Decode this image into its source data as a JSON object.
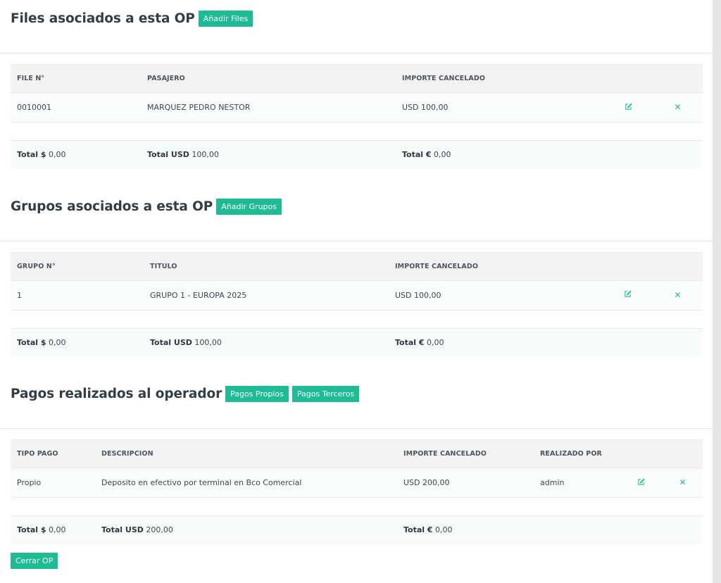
{
  "files_section": {
    "title": "Files asociados a esta OP",
    "add_button": "Añadir Files",
    "headers": [
      "FILE N°",
      "PASAJERO",
      "IMPORTE CANCELADO"
    ],
    "rows": [
      {
        "col1": "0010001",
        "col2": "MARQUEZ PEDRO NESTOR",
        "col3": "USD 100,00"
      }
    ],
    "totals": {
      "ars_label": "Total $",
      "ars_value": "0,00",
      "usd_label": "Total USD",
      "usd_value": "100,00",
      "eur_label": "Total €",
      "eur_value": "0,00"
    }
  },
  "groups_section": {
    "title": "Grupos asociados a esta OP",
    "add_button": "Añadir Grupos",
    "headers": [
      "GRUPO N°",
      "TITULO",
      "IMPORTE CANCELADO"
    ],
    "rows": [
      {
        "col1": "1",
        "col2": "GRUPO 1 - EUROPA 2025",
        "col3": "USD 100,00"
      }
    ],
    "totals": {
      "ars_label": "Total $",
      "ars_value": "0,00",
      "usd_label": "Total USD",
      "usd_value": "100,00",
      "eur_label": "Total €",
      "eur_value": "0,00"
    }
  },
  "payments_section": {
    "title": "Pagos realizados al operador",
    "own_button": "Pagos Propios",
    "third_button": "Pagos Terceros",
    "headers": [
      "TIPO PAGO",
      "DESCRIPCION",
      "IMPORTE CANCELADO",
      "REALIZADO POR"
    ],
    "rows": [
      {
        "col1": "Propio",
        "col2": "Deposito en efectivo por terminal en Bco Comercial",
        "col3": "USD 200,00",
        "col4": "admin"
      }
    ],
    "totals": {
      "ars_label": "Total $",
      "ars_value": "0,00",
      "usd_label": "Total USD",
      "usd_value": "200,00",
      "eur_label": "Total €",
      "eur_value": "0,00"
    }
  },
  "close_button": "Cerrar OP",
  "icons": {
    "edit": "edit-icon",
    "delete": "close-icon"
  },
  "colors": {
    "accent": "#1ebc94"
  }
}
